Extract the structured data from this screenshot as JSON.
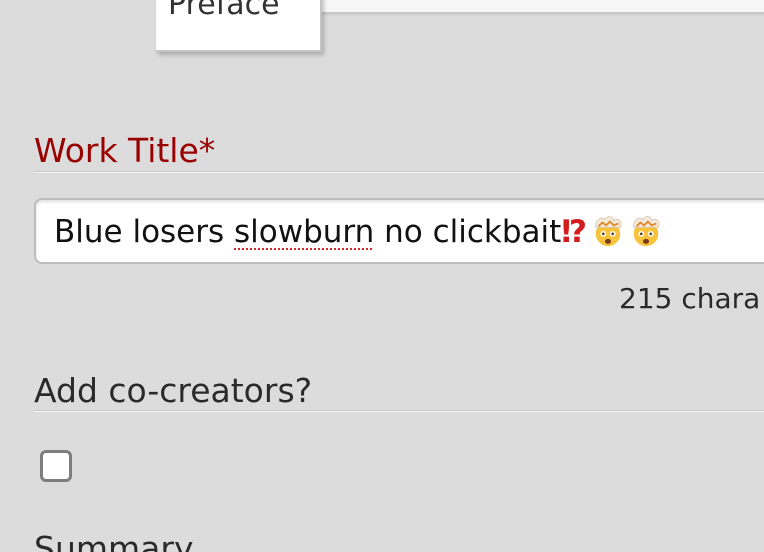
{
  "tabs": {
    "preface_label": "Preface"
  },
  "work_title": {
    "label": "Work Title*",
    "value_parts": {
      "part1": "Blue losers ",
      "misspelled": "slowburn",
      "part2": " no clickbait",
      "punct": "⁉"
    },
    "emoji_icons": [
      "exploding-head-icon",
      "exploding-head-icon"
    ],
    "char_count": "215 chara"
  },
  "co_creators": {
    "label": "Add co-creators?",
    "checked": false
  },
  "summary": {
    "label": "Summary"
  },
  "colors": {
    "background": "#dcdcdc",
    "required_label": "#990000",
    "spell_underline": "#d02828"
  }
}
